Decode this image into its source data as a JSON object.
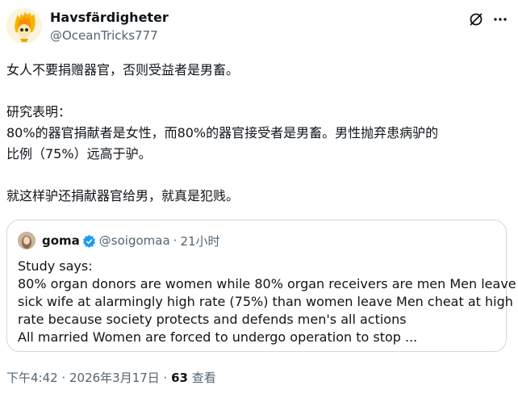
{
  "author": {
    "display_name": "Havsfärdigheter",
    "handle": "@OceanTricks777",
    "avatar_icon": "flaming-skull-avatar"
  },
  "header_actions": {
    "grok_icon": "grok-icon",
    "more_icon": "more-options-icon"
  },
  "tweet": {
    "lines": [
      "女人不要捐赠器官，否则受益者是男畜。",
      "",
      "研究表明：",
      "80%的器官捐献者是女性，而80%的器官接受者是男畜。男性抛弃患病驴的",
      "比例（75%）远高于驴。",
      "",
      "就这样驴还捐献器官给男，就真是犯贱。"
    ]
  },
  "quote": {
    "display_name": "goma",
    "handle": "@soigomaa",
    "separator": "·",
    "time": "21小时",
    "verified_color": "#1d9bf0",
    "lines": [
      "Study says:",
      "80% organ donors are women while 80% organ receivers are men Men leave",
      "sick wife at alarmingly high rate (75%) than women leave Men cheat at high",
      "rate because society protects and defends men's all actions",
      "All married Women are forced to undergo operation to stop ..."
    ]
  },
  "meta": {
    "time_date": "下午4:42 · 2026年3月17日 · ",
    "views_count": "63",
    "views_label": " 查看"
  },
  "colors": {
    "text_primary": "#0f1419",
    "text_secondary": "#536471",
    "border": "#cfd9de",
    "accent": "#1d9bf0"
  }
}
